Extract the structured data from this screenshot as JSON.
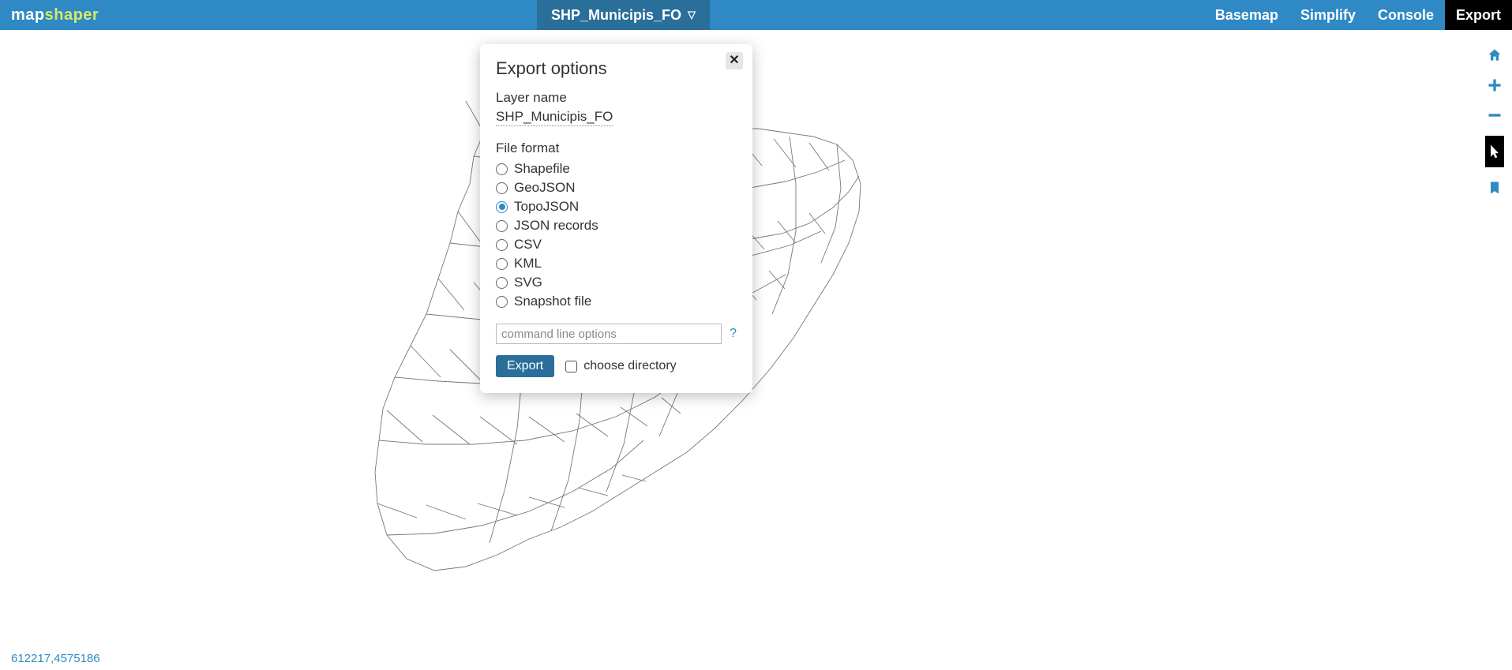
{
  "logo": {
    "left": "map",
    "right": "shaper"
  },
  "layer_tab": {
    "name": "SHP_Municipis_FO"
  },
  "menu": {
    "basemap": "Basemap",
    "simplify": "Simplify",
    "console": "Console",
    "export": "Export"
  },
  "dialog": {
    "title": "Export options",
    "layer_label": "Layer name",
    "layer_name": "SHP_Municipis_FO",
    "format_label": "File format",
    "formats": [
      {
        "label": "Shapefile",
        "checked": false
      },
      {
        "label": "GeoJSON",
        "checked": false
      },
      {
        "label": "TopoJSON",
        "checked": true
      },
      {
        "label": "JSON records",
        "checked": false
      },
      {
        "label": "CSV",
        "checked": false
      },
      {
        "label": "KML",
        "checked": false
      },
      {
        "label": "SVG",
        "checked": false
      },
      {
        "label": "Snapshot file",
        "checked": false
      }
    ],
    "cli_placeholder": "command line options",
    "help": "?",
    "export_btn": "Export",
    "choose_dir": "choose directory"
  },
  "coords": "612217,4575186"
}
